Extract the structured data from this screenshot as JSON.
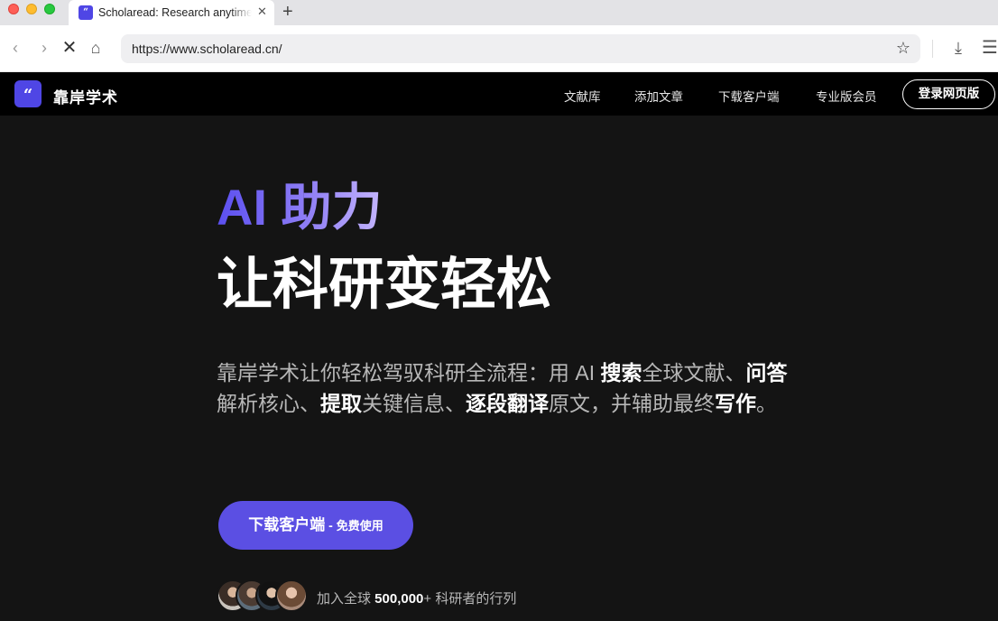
{
  "browser": {
    "tab_title": "Scholaread: Research anytime",
    "tab_favicon": "“",
    "url": "https://www.scholaread.cn/",
    "icons": [
      "back-icon",
      "forward-icon",
      "stop-icon",
      "home-icon",
      "bookmark-star-icon",
      "download-icon",
      "menu-icon"
    ]
  },
  "site": {
    "logo_mark": "“",
    "logo_text": "靠岸学术",
    "nav": [
      "文献库",
      "添加文章",
      "下载客户端",
      "专业版会员"
    ],
    "login_label": "登录网页版"
  },
  "hero": {
    "title_line1": "AI 助力",
    "title_line2": "让科研变轻松",
    "desc": {
      "p1": "靠岸学术让你轻松驾驭科研全流程：用 AI ",
      "b1": "搜索",
      "p2": "全球文献、",
      "b2": "问答",
      "p3": "解析核心、",
      "b3": "提取",
      "p4": "关键信息、",
      "b4": "逐段翻译",
      "p5": "原文，并辅助最终",
      "b5": "写作",
      "p6": "。"
    },
    "cta_main": "下载客户端",
    "cta_sep": " - ",
    "cta_sub": "免费使用",
    "join_prefix": "加入全球 ",
    "join_count": "500,000",
    "join_suffix": "+ 科研者的行列"
  },
  "colors": {
    "accent": "#5b4fe3",
    "brand": "#4f46e5",
    "hero_bg": "#141414"
  }
}
